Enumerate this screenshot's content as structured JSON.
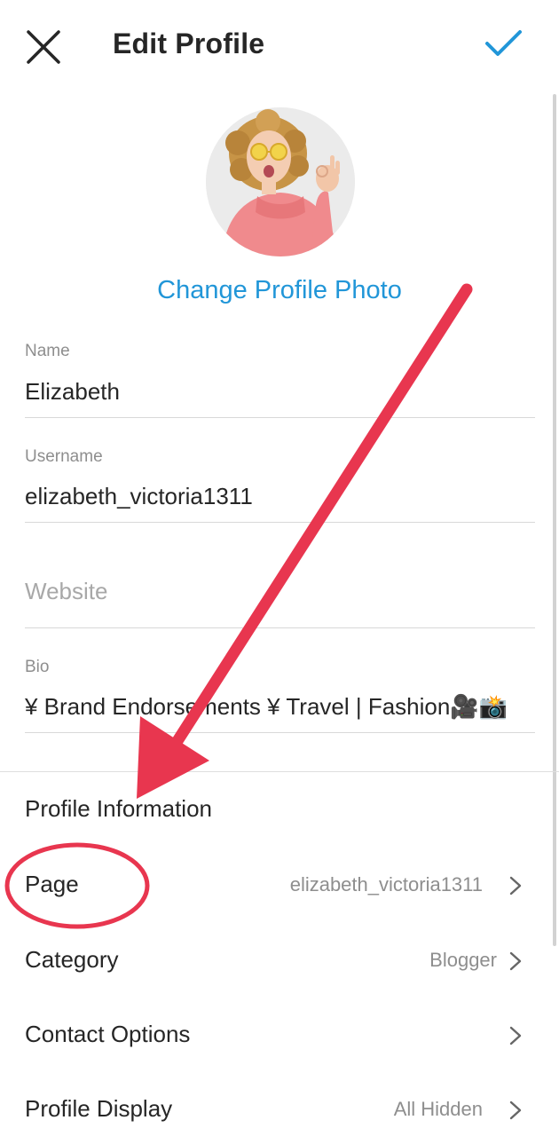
{
  "header": {
    "title": "Edit Profile"
  },
  "profile": {
    "change_photo_label": "Change Profile Photo"
  },
  "fields": {
    "name": {
      "label": "Name",
      "value": "Elizabeth"
    },
    "username": {
      "label": "Username",
      "value": "elizabeth_victoria1311"
    },
    "website": {
      "placeholder": "Website"
    },
    "bio": {
      "label": "Bio",
      "value": "¥ Brand Endorsements ¥ Travel | Fashion🎥📸"
    }
  },
  "profile_information": {
    "title": "Profile Information",
    "rows": [
      {
        "label": "Page",
        "value": "elizabeth_victoria1311"
      },
      {
        "label": "Category",
        "value": "Blogger"
      },
      {
        "label": "Contact Options",
        "value": ""
      },
      {
        "label": "Profile Display",
        "value": "All Hidden"
      }
    ]
  },
  "colors": {
    "accent": "#2196d8",
    "annotation": "#e8364f",
    "text": "#262626",
    "secondary_text": "#8e8e8e"
  },
  "icons": {
    "close": "close-icon",
    "done": "checkmark-icon",
    "chevron": "chevron-right-icon"
  }
}
